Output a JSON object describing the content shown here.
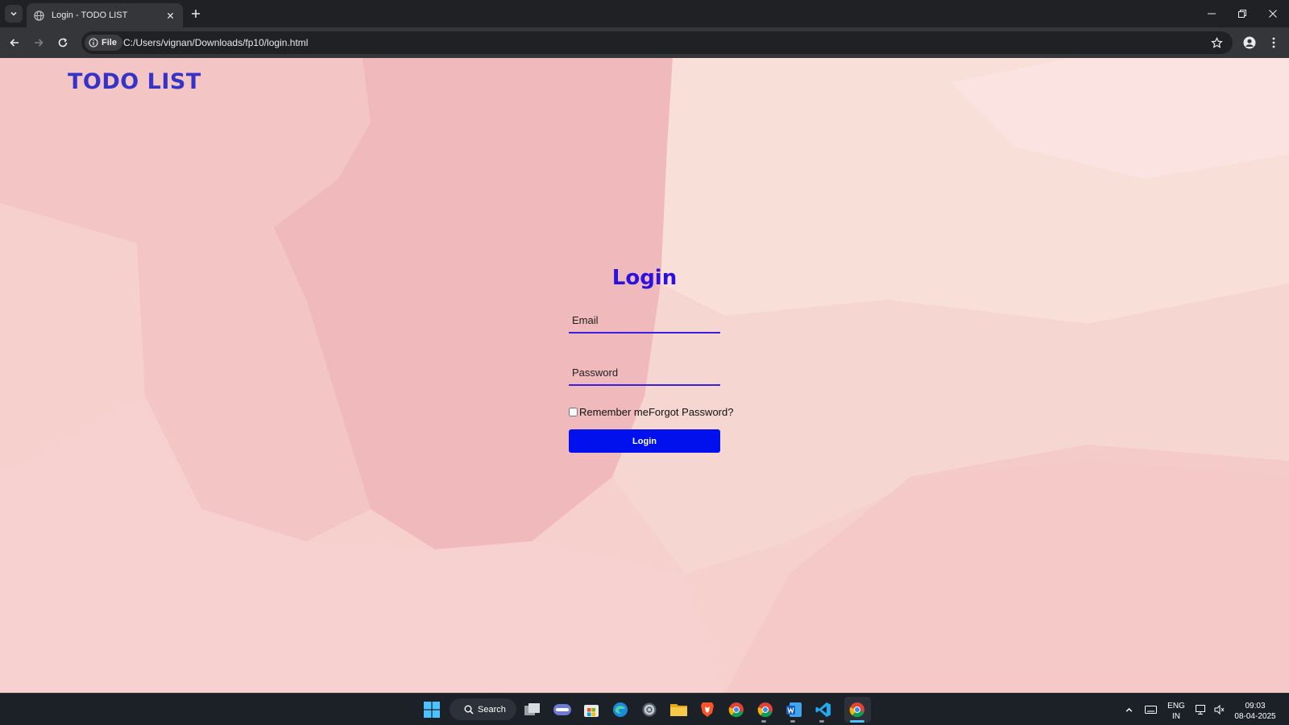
{
  "browser": {
    "tab_title": "Login - TODO LIST",
    "url": "C:/Users/vignan/Downloads/fp10/login.html",
    "security_chip_label": "File"
  },
  "page": {
    "brand": "TODO LIST",
    "login_title": "Login",
    "email_placeholder": "Email",
    "email_value": "",
    "password_placeholder": "Password",
    "password_value": "",
    "remember_label": "Remember me",
    "remember_checked": false,
    "forgot_label": "Forgot Password?",
    "login_button": "Login"
  },
  "taskbar": {
    "search_label": "Search",
    "apps": [
      "windows-start",
      "task-view",
      "copilot",
      "microsoft-store",
      "edge",
      "settings",
      "file-explorer",
      "brave",
      "chrome",
      "chrome",
      "word",
      "vs-code",
      "chrome"
    ],
    "language": "ENG",
    "region": "IN",
    "time": "09:03",
    "date": "08-04-2025"
  },
  "colors": {
    "brand_text": "#3634c6",
    "login_title": "#2b12e0",
    "field_underline": "#3a1fe0",
    "login_button_bg": "#0011ee",
    "page_background": "#f6d0cc",
    "taskbar_bg": "#1c2027"
  }
}
